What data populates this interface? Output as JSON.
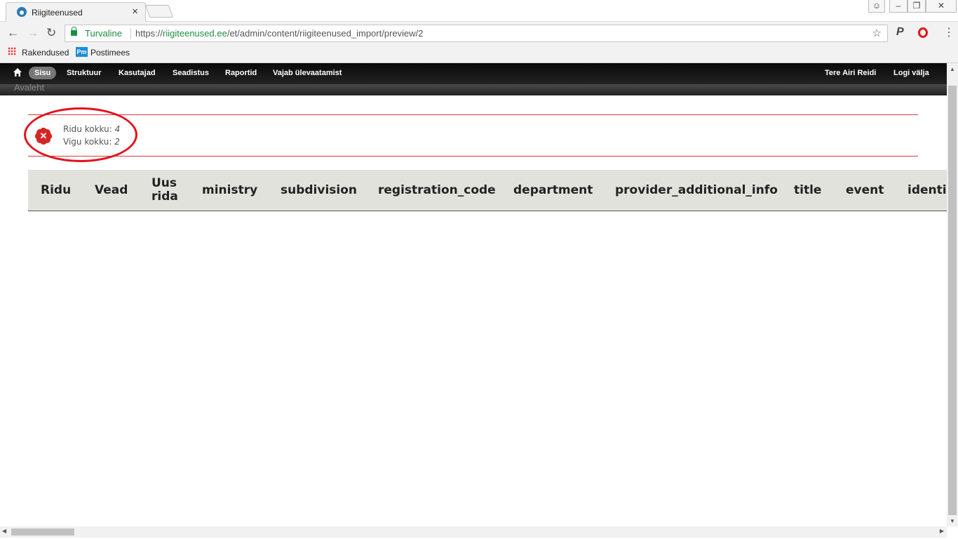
{
  "browser": {
    "tab_title": "Riigiteenused",
    "security_label": "Turvaline",
    "url_scheme": "https://",
    "url_host": "riigiteenused.ee",
    "url_path": "/et/admin/content/riigiteenused_import/preview/2",
    "bookmarks": [
      {
        "label": "Rakendused"
      },
      {
        "label": "Postimees"
      }
    ]
  },
  "toolbar": {
    "items": [
      {
        "label": "Sisu"
      },
      {
        "label": "Struktuur"
      },
      {
        "label": "Kasutajad"
      },
      {
        "label": "Seadistus"
      },
      {
        "label": "Raportid"
      },
      {
        "label": "Vajab ülevaatamist"
      }
    ],
    "greeting": "Tere",
    "user": "Airi Reidi",
    "logout": "Logi välja",
    "shortcut": "Avaleht"
  },
  "message": {
    "rows_label": "Ridu kokku:",
    "rows_value": "4",
    "errors_label": "Vigu kokku:",
    "errors_value": "2"
  },
  "table": {
    "headers": [
      "Ridu",
      "Vead",
      "Uus rida",
      "ministry",
      "subdivision",
      "registration_code",
      "department",
      "provider_additional_info",
      "title",
      "event",
      "identi"
    ]
  },
  "colors": {
    "accent_red": "#d8393e",
    "annotation_red": "#e3121b",
    "secure_green": "#1e8e3e"
  }
}
